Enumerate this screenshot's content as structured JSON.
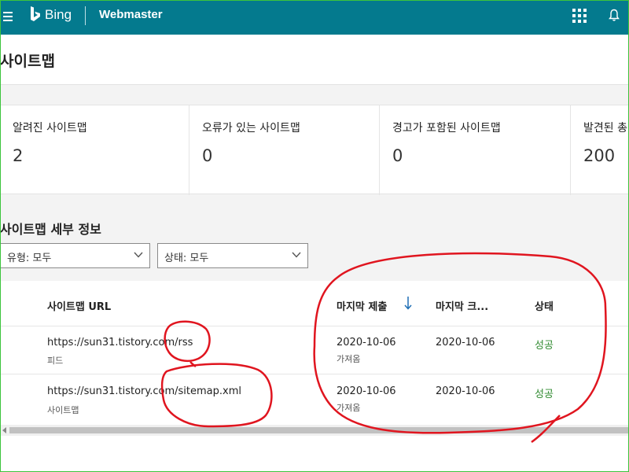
{
  "header": {
    "brand": "Bing",
    "product": "Webmaster"
  },
  "page": {
    "title": "사이트맵"
  },
  "stats": [
    {
      "label": "알려진 사이트맵",
      "value": "2"
    },
    {
      "label": "오류가 있는 사이트맵",
      "value": "0"
    },
    {
      "label": "경고가 포함된 사이트맵",
      "value": "0"
    },
    {
      "label": "발견된 총",
      "value": "200"
    }
  ],
  "details": {
    "title": "사이트맵 세부 정보",
    "filter_type": "유형: 모두",
    "filter_status": "상태: 모두"
  },
  "table": {
    "headers": {
      "url": "사이트맵 URL",
      "last_submitted": "마지막 제출",
      "last_crawled": "마지막 크...",
      "status": "상태"
    },
    "rows": [
      {
        "url": "https://sun31.tistory.com/rss",
        "kind": "피드",
        "submitted": "2020-10-06",
        "submitted_sub": "가져옴",
        "crawled": "2020-10-06",
        "status": "성공"
      },
      {
        "url": "https://sun31.tistory.com/sitemap.xml",
        "kind": "사이트맵",
        "submitted": "2020-10-06",
        "submitted_sub": "가져옴",
        "crawled": "2020-10-06",
        "status": "성공"
      }
    ]
  },
  "colors": {
    "header_bg": "#047a8e",
    "success": "#2f8a2f",
    "annotation": "#e0151f"
  }
}
